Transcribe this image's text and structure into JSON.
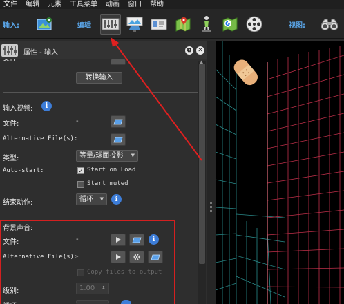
{
  "menubar": {
    "items": [
      "文件",
      "编辑",
      "元素",
      "工具菜单",
      "动画",
      "窗口",
      "帮助"
    ]
  },
  "toolbar": {
    "input_label": "输入:",
    "edit_label": "编辑",
    "view_label": "视图:",
    "buttons": [
      "add-input-icon",
      "equalizer-icon",
      "projector-icon",
      "id-card-icon",
      "map-pin-icon",
      "person-stand-icon",
      "google-maps-icon",
      "film-reel-icon",
      "binoculars-icon"
    ]
  },
  "panel": {
    "title": "属性 - 输入",
    "truncated_top_label": "文件",
    "convert_input_button": "转换输入",
    "input_video_label": "输入视频:",
    "file_label": "文件:",
    "file_value": "-",
    "alt_files_label": "Alternative File(s):",
    "type_label": "类型:",
    "type_value": "等量/球面投影",
    "autostart_label": "Auto-start:",
    "start_on_load_label": "Start on Load",
    "start_on_load_checked": true,
    "start_muted_label": "Start muted",
    "start_muted_checked": false,
    "end_action_label": "结束动作:",
    "end_action_value": "循环",
    "bg_sound_label": "背景声音:",
    "bg_file_label": "文件:",
    "bg_file_value": "-",
    "bg_alt_files_label": "Alternative File(s):",
    "bg_alt_files_value": "-",
    "copy_files_label": "Copy files to output",
    "level_label": "级别:",
    "level_value": "1.00",
    "loop_label": "循环"
  },
  "colors": {
    "accent_blue": "#5aa5e8",
    "highlight_red": "#d42020",
    "grid_red": "#c0304a",
    "grid_teal": "#2a8a8a"
  }
}
